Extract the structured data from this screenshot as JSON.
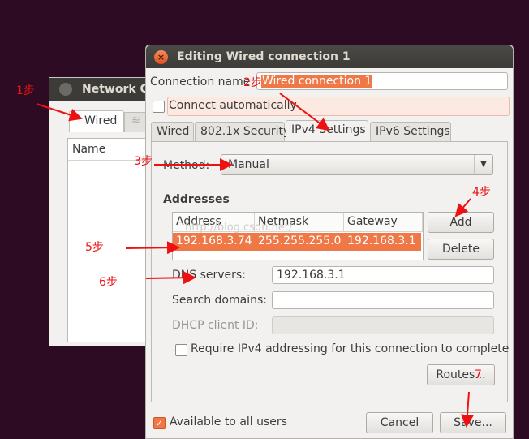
{
  "bg_window": {
    "title": "Network C",
    "tab_label": "Wired",
    "list_header": "Name"
  },
  "dialog": {
    "title": "Editing Wired connection 1",
    "conn_name_label": "Connection name:",
    "conn_name_value": "Wired connection 1",
    "connect_auto": "Connect automatically",
    "tabs": [
      "Wired",
      "802.1x Security",
      "IPv4 Settings",
      "IPv6 Settings"
    ],
    "method_label": "Method:",
    "method_value": "Manual",
    "addresses_heading": "Addresses",
    "columns": [
      "Address",
      "Netmask",
      "Gateway"
    ],
    "row": {
      "address": "192.168.3.74",
      "netmask": "255.255.255.0",
      "gateway": "192.168.3.1"
    },
    "add_label": "Add",
    "delete_label": "Delete",
    "dns_label": "DNS servers:",
    "dns_value": "192.168.3.1",
    "search_label": "Search domains:",
    "dhcp_label": "DHCP client ID:",
    "require_label": "Require IPv4 addressing for this connection to complete",
    "routes_label": "Routes...",
    "available_label": "Available to all users",
    "cancel_label": "Cancel",
    "save_label": "Save..."
  },
  "watermark": "http://blog.csdn.net/",
  "annotations": [
    "1步",
    "2步",
    "3步",
    "4步",
    "5步",
    "6步",
    "7"
  ],
  "colors": {
    "accent": "#f07746",
    "annotation": "#ee1111",
    "titlebar": "#3c3b37",
    "desktop": "#2c0b23"
  }
}
